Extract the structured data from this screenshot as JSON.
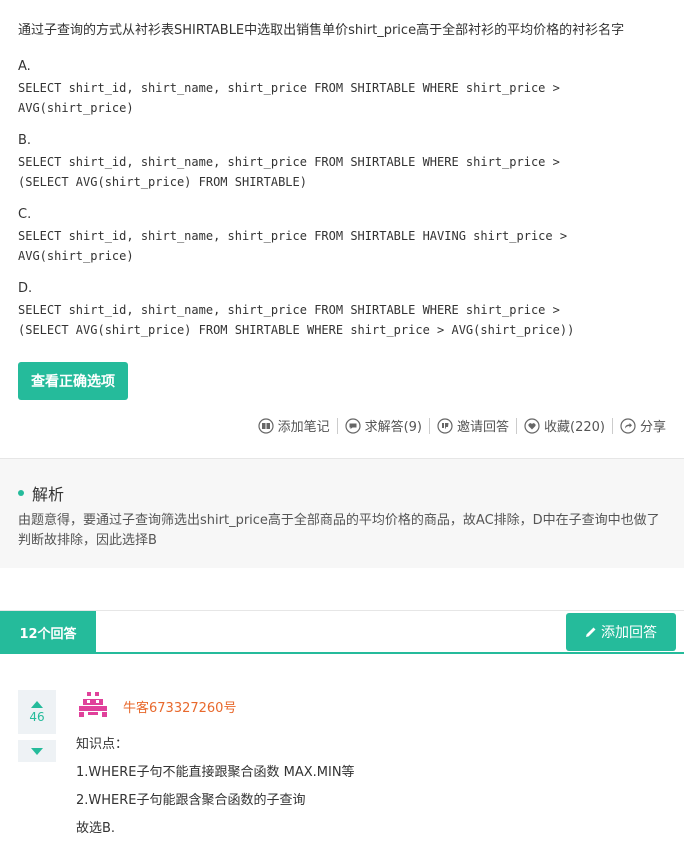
{
  "question": {
    "text": "通过子查询的方式从衬衫表SHIRTABLE中选取出销售单价shirt_price高于全部衬衫的平均价格的衬衫名字"
  },
  "options": [
    {
      "letter": "A.",
      "code": "SELECT shirt_id, shirt_name, shirt_price FROM SHIRTABLE WHERE shirt_price >\nAVG(shirt_price)"
    },
    {
      "letter": "B.",
      "code": "SELECT shirt_id, shirt_name, shirt_price FROM SHIRTABLE WHERE shirt_price >\n(SELECT AVG(shirt_price) FROM SHIRTABLE)"
    },
    {
      "letter": "C.",
      "code": "SELECT shirt_id, shirt_name, shirt_price FROM SHIRTABLE HAVING shirt_price >\nAVG(shirt_price)"
    },
    {
      "letter": "D.",
      "code": "SELECT shirt_id, shirt_name, shirt_price FROM SHIRTABLE WHERE shirt_price >\n(SELECT AVG(shirt_price) FROM SHIRTABLE WHERE shirt_price > AVG(shirt_price))"
    }
  ],
  "buttons": {
    "view_answer": "查看正确选项",
    "add_answer": "添加回答"
  },
  "actions": {
    "add_note": "添加笔记",
    "ask": "求解答(9)",
    "invite": "邀请回答",
    "collect": "收藏(220)",
    "share": "分享"
  },
  "analysis": {
    "title": "解析",
    "body": "由题意得，要通过子查询筛选出shirt_price高于全部商品的平均价格的商品，故AC排除，D中在子查询中也做了判断故排除，因此选择B"
  },
  "answers": {
    "tab_label": "12个回答",
    "first": {
      "votes": "46",
      "username": "牛客673327260号",
      "lines": [
        "知识点：",
        "1.WHERE子句不能直接跟聚合函数 MAX.MIN等",
        "2.WHERE子句能跟含聚合函数的子查询",
        "故选B."
      ]
    }
  },
  "colors": {
    "accent": "#25bb9b",
    "username": "#e8692d",
    "avatar": "#e0419b"
  },
  "icons": [
    "book-icon",
    "chat-icon",
    "thumb-icon",
    "heart-icon",
    "share-icon",
    "pencil-icon",
    "vote-up-icon",
    "vote-down-icon"
  ]
}
